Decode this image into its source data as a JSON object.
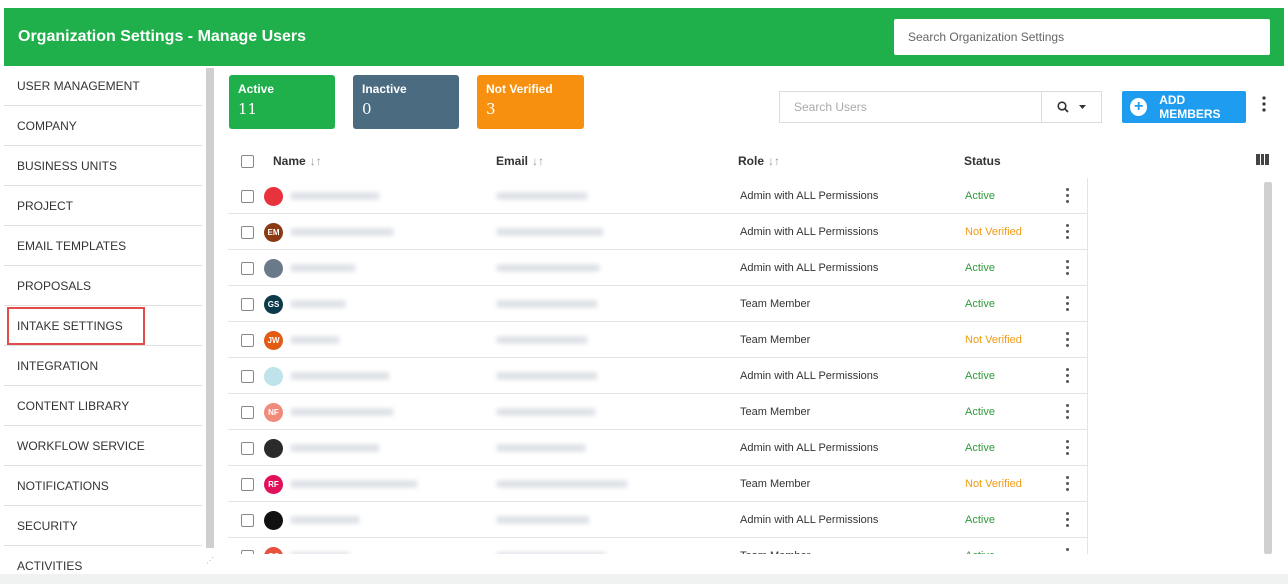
{
  "header": {
    "title": "Organization Settings - Manage Users",
    "search_placeholder": "Search Organization Settings"
  },
  "sidebar": {
    "items": [
      {
        "label": "USER MANAGEMENT"
      },
      {
        "label": "COMPANY"
      },
      {
        "label": "BUSINESS UNITS"
      },
      {
        "label": "PROJECT"
      },
      {
        "label": "EMAIL TEMPLATES"
      },
      {
        "label": "PROPOSALS"
      },
      {
        "label": "INTAKE SETTINGS",
        "highlighted": true
      },
      {
        "label": "INTEGRATION"
      },
      {
        "label": "CONTENT LIBRARY"
      },
      {
        "label": "WORKFLOW SERVICE"
      },
      {
        "label": "NOTIFICATIONS"
      },
      {
        "label": "SECURITY"
      },
      {
        "label": "ACTIVITIES"
      }
    ]
  },
  "stats": {
    "active": {
      "label": "Active",
      "value": "11",
      "color": "#1fb04b"
    },
    "inactive": {
      "label": "Inactive",
      "value": "0",
      "color": "#4a6b80"
    },
    "not_verified": {
      "label": "Not Verified",
      "value": "3",
      "color": "#f7900e"
    }
  },
  "toolbar": {
    "search_placeholder": "Search Users",
    "add_label": "ADD MEMBERS"
  },
  "table": {
    "columns": {
      "name": "Name",
      "email": "Email",
      "role": "Role",
      "status": "Status"
    },
    "rows": [
      {
        "avatar": "",
        "avatar_color": "#e8323c",
        "avatar_icon": "e-logo-icon",
        "role": "Admin with ALL Permissions",
        "status": "Active"
      },
      {
        "avatar": "EM",
        "avatar_color": "#8b3a14",
        "role": "Admin with ALL Permissions",
        "status": "Not Verified"
      },
      {
        "avatar": "",
        "avatar_color": "#6b7a8a",
        "avatar_icon": "photo-avatar-icon",
        "role": "Admin with ALL Permissions",
        "status": "Active"
      },
      {
        "avatar": "GS",
        "avatar_color": "#0d3a4a",
        "role": "Team Member",
        "status": "Active"
      },
      {
        "avatar": "JW",
        "avatar_color": "#e35a12",
        "role": "Team Member",
        "status": "Not Verified"
      },
      {
        "avatar": "",
        "avatar_color": "#bfe3ea",
        "avatar_icon": "logo-avatar-icon",
        "role": "Admin with ALL Permissions",
        "status": "Active"
      },
      {
        "avatar": "NF",
        "avatar_color": "#f08a7a",
        "role": "Team Member",
        "status": "Active"
      },
      {
        "avatar": "",
        "avatar_color": "#2b2b2b",
        "avatar_icon": "photo-avatar-icon",
        "role": "Admin with ALL Permissions",
        "status": "Active"
      },
      {
        "avatar": "RF",
        "avatar_color": "#e0105a",
        "role": "Team Member",
        "status": "Not Verified"
      },
      {
        "avatar": "",
        "avatar_color": "#111111",
        "avatar_icon": "bat-logo-icon",
        "role": "Admin with ALL Permissions",
        "status": "Active"
      },
      {
        "avatar": "GS",
        "avatar_color": "#e8523c",
        "role": "Team Member",
        "status": "Active"
      }
    ]
  },
  "colors": {
    "header": "#1fb04b",
    "primary_button": "#1e9cf0",
    "status_active": "#2e9a3a",
    "status_not_verified": "#ef9a10"
  }
}
